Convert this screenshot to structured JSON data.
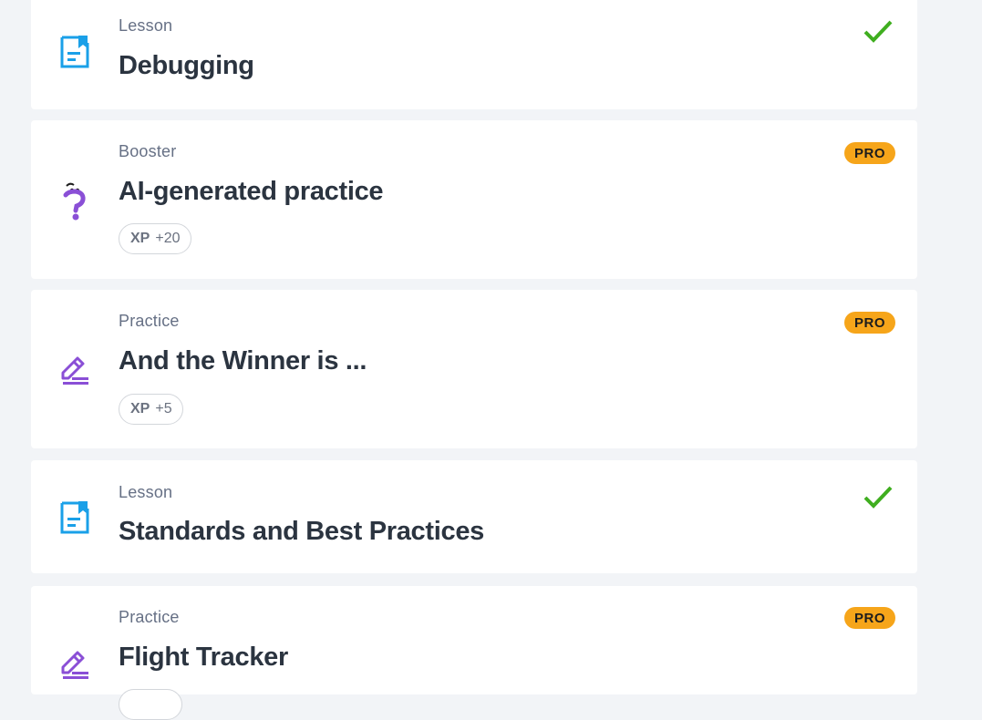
{
  "items": [
    {
      "kind": "Lesson",
      "title": "Debugging",
      "icon": "lesson-icon",
      "status": "completed"
    },
    {
      "kind": "Booster",
      "title": "AI-generated practice",
      "icon": "question-mark-icon",
      "badge": "PRO",
      "xp_label": "XP",
      "xp_value": "+20"
    },
    {
      "kind": "Practice",
      "title": "And the Winner is ...",
      "icon": "pencil-icon",
      "badge": "PRO",
      "xp_label": "XP",
      "xp_value": "+5"
    },
    {
      "kind": "Lesson",
      "title": "Standards and Best Practices",
      "icon": "lesson-icon",
      "status": "completed"
    },
    {
      "kind": "Practice",
      "title": "Flight Tracker",
      "icon": "pencil-icon",
      "badge": "PRO"
    }
  ],
  "colors": {
    "lesson_icon": "#1aa0e8",
    "practice_icon": "#8a4fd6",
    "check": "#3fae1f",
    "pro_badge": "#f6a51a"
  }
}
